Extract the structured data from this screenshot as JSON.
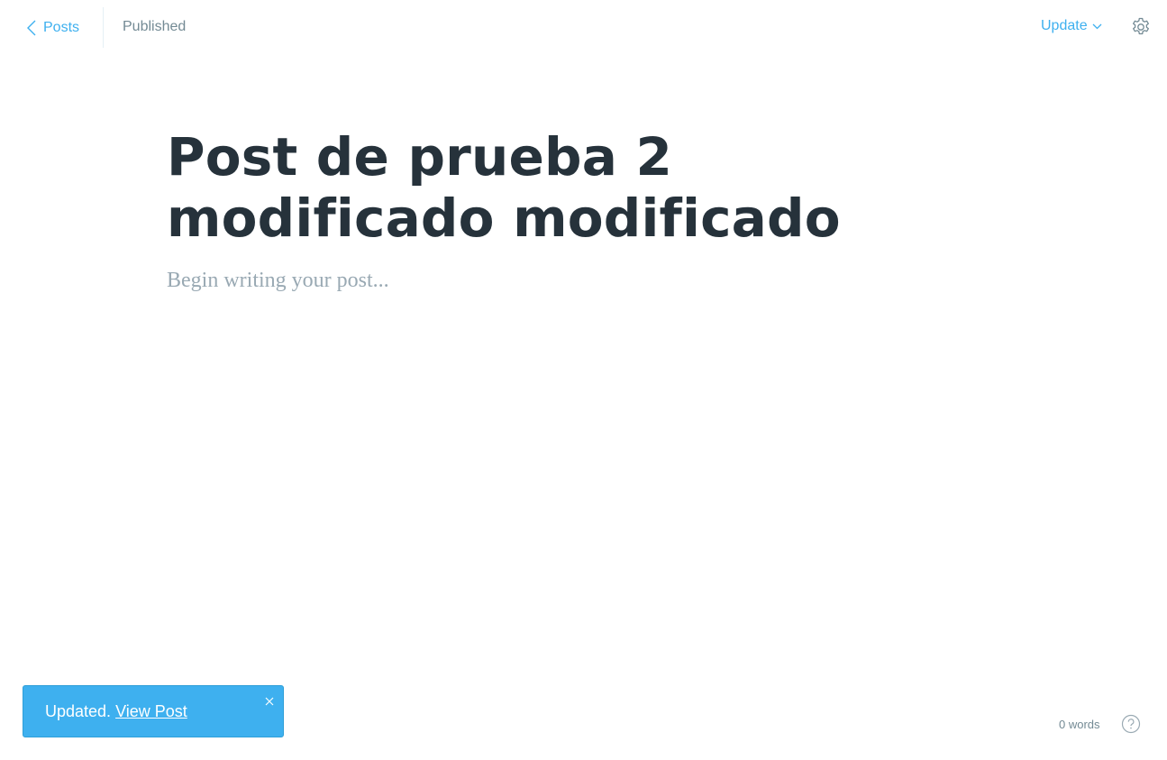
{
  "header": {
    "back_label": "Posts",
    "status": "Published",
    "update_label": "Update"
  },
  "editor": {
    "title": "Post de prueba 2 modificado modificado",
    "body_placeholder": "Begin writing your post..."
  },
  "toast": {
    "message": "Updated.",
    "link_label": "View Post"
  },
  "footer": {
    "word_count": "0 words"
  },
  "icons": {
    "back": "chevron-left-icon",
    "update_caret": "chevron-down-icon",
    "settings": "gear-icon",
    "close": "close-icon",
    "help": "question-circle-icon"
  },
  "colors": {
    "accent": "#3eb0ef",
    "title": "#26323b",
    "muted": "#738a94",
    "placeholder": "#99a9b3"
  }
}
